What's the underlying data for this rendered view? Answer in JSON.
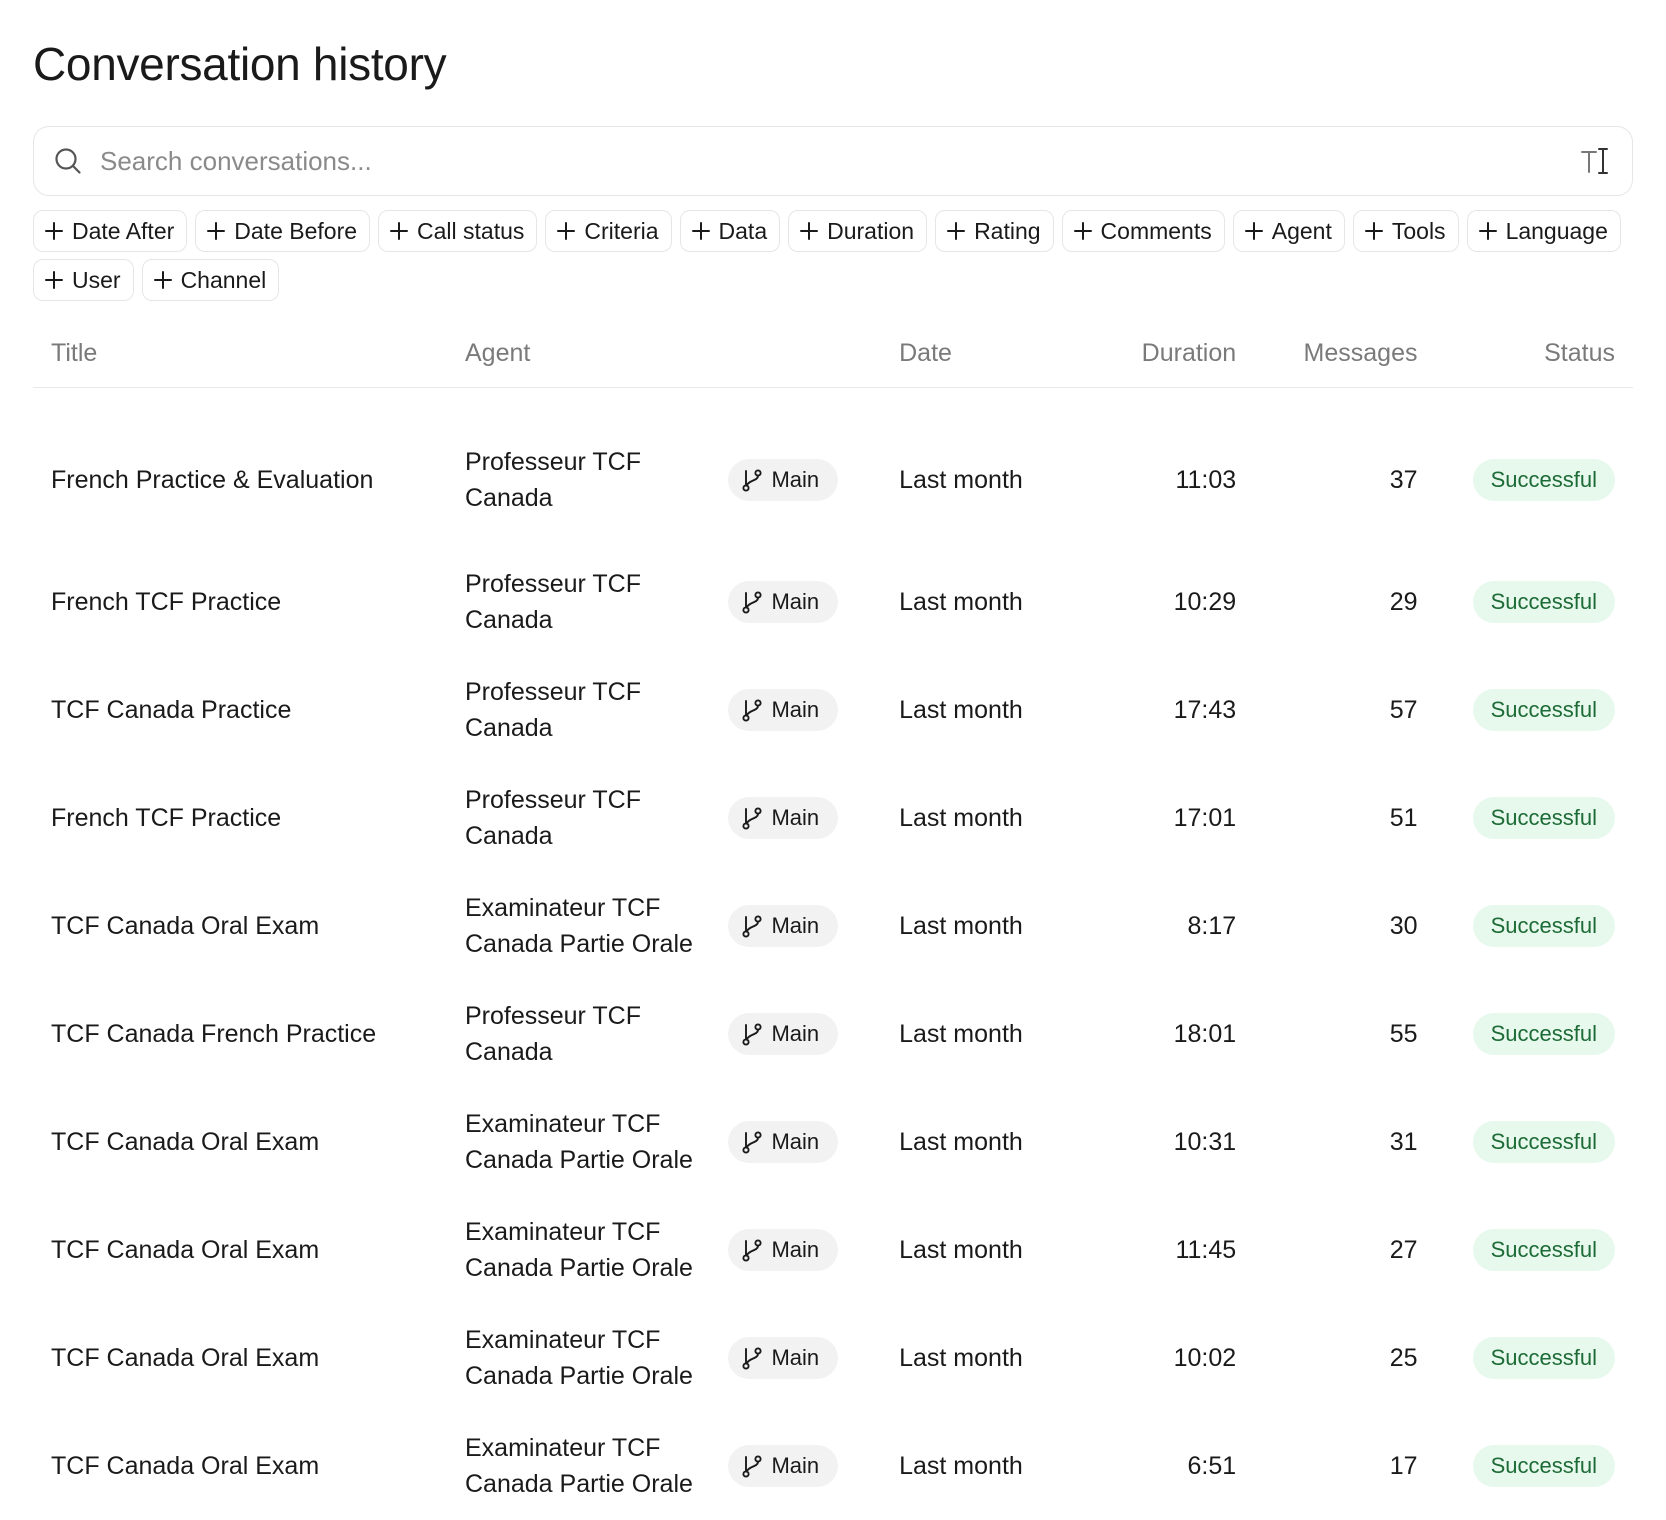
{
  "page": {
    "title": "Conversation history"
  },
  "search": {
    "placeholder": "Search conversations...",
    "icon": "search-icon",
    "mode_icon": "text-cursor-icon"
  },
  "filters": [
    "Date After",
    "Date Before",
    "Call status",
    "Criteria",
    "Data",
    "Duration",
    "Rating",
    "Comments",
    "Agent",
    "Tools",
    "Language",
    "User",
    "Channel"
  ],
  "table": {
    "columns": [
      "Title",
      "Agent",
      "Date",
      "Duration",
      "Messages",
      "Status"
    ],
    "rows": [
      {
        "title": "French Practice & Evaluation",
        "agent_line1": "Professeur TCF",
        "agent_line2": "Canada",
        "branch": "Main",
        "date": "Last month",
        "duration": "11:03",
        "messages": "37",
        "status": "Successful"
      },
      {
        "title": "French TCF Practice",
        "agent_line1": "Professeur TCF",
        "agent_line2": "Canada",
        "branch": "Main",
        "date": "Last month",
        "duration": "10:29",
        "messages": "29",
        "status": "Successful"
      },
      {
        "title": "TCF Canada Practice",
        "agent_line1": "Professeur TCF",
        "agent_line2": "Canada",
        "branch": "Main",
        "date": "Last month",
        "duration": "17:43",
        "messages": "57",
        "status": "Successful"
      },
      {
        "title": "French TCF Practice",
        "agent_line1": "Professeur TCF",
        "agent_line2": "Canada",
        "branch": "Main",
        "date": "Last month",
        "duration": "17:01",
        "messages": "51",
        "status": "Successful"
      },
      {
        "title": "TCF Canada Oral Exam",
        "agent_line1": "Examinateur TCF",
        "agent_line2": "Canada Partie Orale",
        "branch": "Main",
        "date": "Last month",
        "duration": "8:17",
        "messages": "30",
        "status": "Successful"
      },
      {
        "title": "TCF Canada French Practice",
        "agent_line1": "Professeur TCF",
        "agent_line2": "Canada",
        "branch": "Main",
        "date": "Last month",
        "duration": "18:01",
        "messages": "55",
        "status": "Successful"
      },
      {
        "title": "TCF Canada Oral Exam",
        "agent_line1": "Examinateur TCF",
        "agent_line2": "Canada Partie Orale",
        "branch": "Main",
        "date": "Last month",
        "duration": "10:31",
        "messages": "31",
        "status": "Successful"
      },
      {
        "title": "TCF Canada Oral Exam",
        "agent_line1": "Examinateur TCF",
        "agent_line2": "Canada Partie Orale",
        "branch": "Main",
        "date": "Last month",
        "duration": "11:45",
        "messages": "27",
        "status": "Successful"
      },
      {
        "title": "TCF Canada Oral Exam",
        "agent_line1": "Examinateur TCF",
        "agent_line2": "Canada Partie Orale",
        "branch": "Main",
        "date": "Last month",
        "duration": "10:02",
        "messages": "25",
        "status": "Successful"
      },
      {
        "title": "TCF Canada Oral Exam",
        "agent_line1": "Examinateur TCF",
        "agent_line2": "Canada Partie Orale",
        "branch": "Main",
        "date": "Last month",
        "duration": "6:51",
        "messages": "17",
        "status": "Successful"
      }
    ]
  },
  "colors": {
    "status_bg": "#e7f8ec",
    "status_text": "#1d6b36",
    "branch_bg": "#f2f2f2",
    "muted_text": "#7a7a7a"
  }
}
